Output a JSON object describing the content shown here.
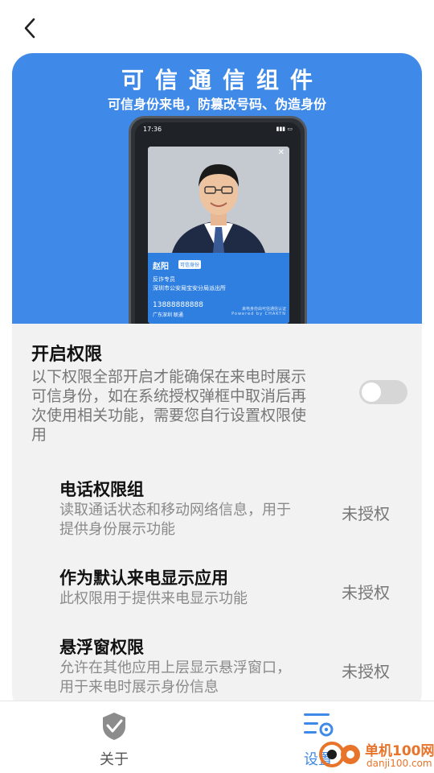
{
  "nav": {
    "back_icon": "chevron-left-icon"
  },
  "banner": {
    "title": "可信通信组件",
    "subtitle": "可信身份来电，防篡改号码、伪造身份",
    "phone": {
      "time": "17:36",
      "caller_name": "赵阳",
      "verified_badge": "可信身份",
      "role": "反诈专员",
      "organization": "深圳市公安局宝安分局派出所",
      "number": "13888888888",
      "location": "广东深圳 联通",
      "powered_line1": "来电身份由可信通信认证",
      "powered_line2": "Powered by CHAKTN"
    }
  },
  "permissions": {
    "title": "开启权限",
    "description": "以下权限全部开启才能确保在来电时展示可信身份，如在系统授权弹框中取消后再次使用相关功能，需要您自行设置权限使用",
    "toggle_on": false,
    "items": [
      {
        "title": "电话权限组",
        "description": "读取通话状态和移动网络信息，用于提供身份展示功能",
        "status": "未授权"
      },
      {
        "title": "作为默认来电显示应用",
        "description": "此权限用于提供来电显示功能",
        "status": "未授权"
      },
      {
        "title": "悬浮窗权限",
        "description": "允许在其他应用上层显示悬浮窗口，用于来电时展示身份信息",
        "status": "未授权"
      }
    ]
  },
  "tabbar": {
    "tabs": [
      {
        "label": "关于",
        "icon": "shield-check-icon",
        "active": false
      },
      {
        "label": "设置",
        "icon": "settings-list-icon",
        "active": true
      }
    ]
  },
  "watermark": {
    "text": "单机100网",
    "url": "danji100.com"
  },
  "colors": {
    "accent": "#3f8ae8",
    "inactive": "#8a8a8a",
    "card_bg": "#f2f2f2"
  }
}
